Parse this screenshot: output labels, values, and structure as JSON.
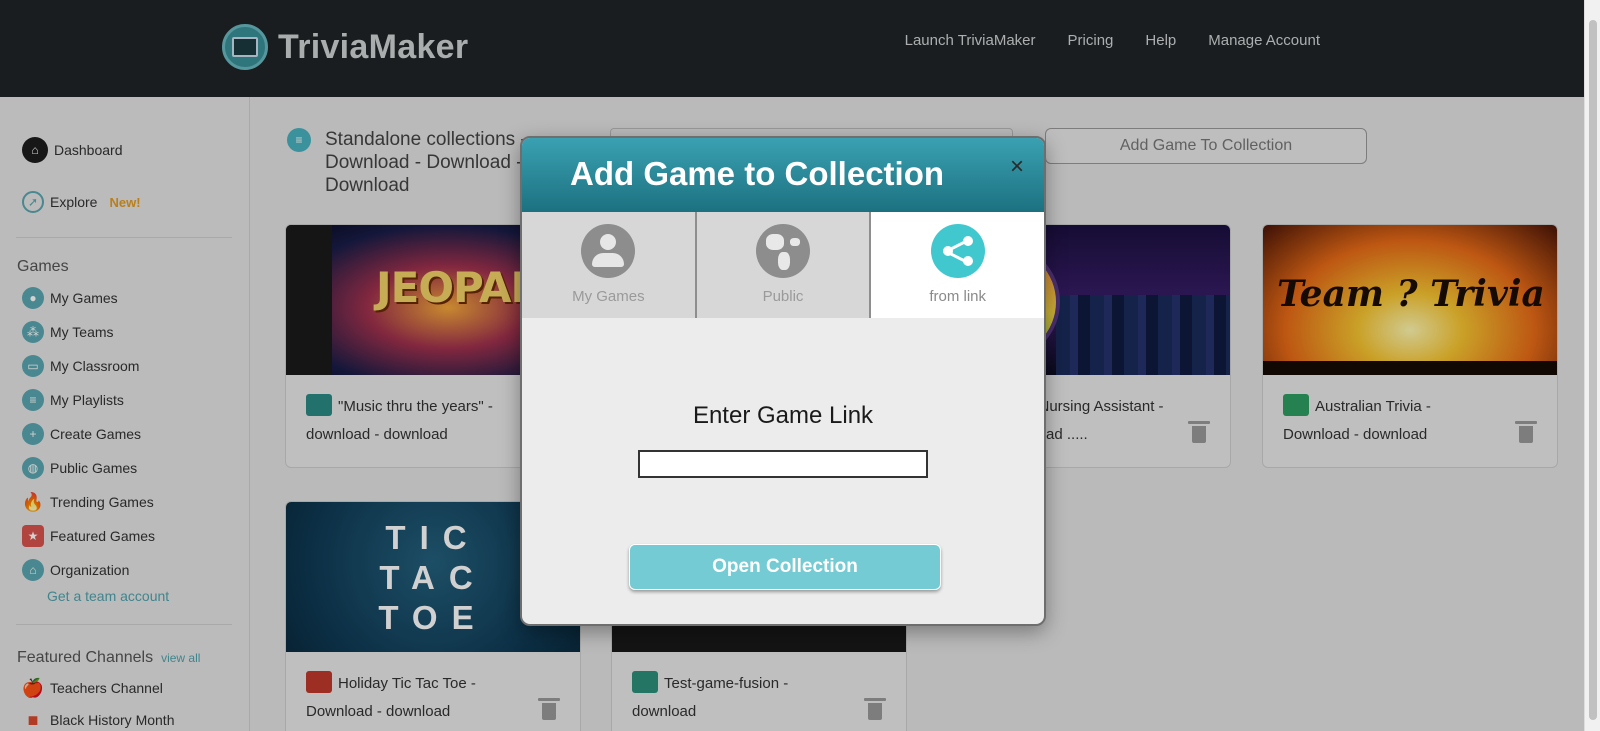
{
  "header": {
    "logo_text": "TriviaMaker",
    "nav": [
      "Launch TriviaMaker",
      "Pricing",
      "Help",
      "Manage Account"
    ]
  },
  "sidebar": {
    "dashboard": "Dashboard",
    "explore": "Explore",
    "explore_badge": "New!",
    "games_heading": "Games",
    "items": [
      "My Games",
      "My Teams",
      "My Classroom",
      "My Playlists",
      "Create Games",
      "Public Games",
      "Trending Games",
      "Featured Games",
      "Organization"
    ],
    "team_link": "Get a team account",
    "channels_heading": "Featured Channels",
    "view_all": "view all",
    "channels": [
      "Teachers Channel",
      "Black History Month"
    ]
  },
  "main": {
    "breadcrumb": "Standalone collections - Download - Download - Download",
    "add_to_collection": "Add Game To Collection",
    "cards": [
      {
        "title": "\"Music thru the years\" - download - download"
      },
      {
        "title": "d Nursing Assistant - nload ....."
      },
      {
        "title": "Australian Trivia - Download - download"
      },
      {
        "title": "Holiday Tic Tac Toe - Download - download"
      },
      {
        "title": "Test-game-fusion - download"
      }
    ],
    "jeopardy_text": "JEOPARDY!",
    "team_trivia_text": "Team ? Trivia",
    "tictactoe_text": "TIC TAC TOE"
  },
  "modal": {
    "title": "Add Game to Collection",
    "close": "×",
    "tabs": [
      "My Games",
      "Public",
      "from link"
    ],
    "active_tab": "from link",
    "link_label": "Enter Game Link",
    "link_value": "",
    "button_label": "Open Collection"
  },
  "colors": {
    "accent": "#41c8cf",
    "header_bg": "#1f2426",
    "button": "#75cbd3"
  }
}
